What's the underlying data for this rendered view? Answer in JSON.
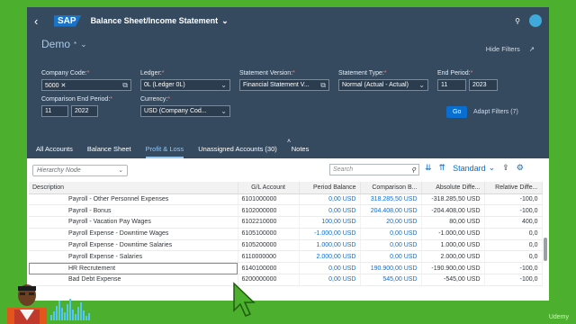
{
  "shell": {
    "brand": "SAP",
    "app_title": "Balance Sheet/Income Statement",
    "avatar_initials": ""
  },
  "header": {
    "variant": "Demo",
    "variant_marker": "*",
    "hide_filters": "Hide Filters",
    "go": "Go",
    "adapt_filters": "Adapt Filters (7)"
  },
  "filters": {
    "company_code": {
      "label": "Company Code:",
      "value": "5000"
    },
    "ledger": {
      "label": "Ledger:",
      "value": "0L (Ledger 0L)"
    },
    "statement_version": {
      "label": "Statement Version:",
      "value": "Financial Statement V..."
    },
    "statement_type": {
      "label": "Statement Type:",
      "value": "Normal (Actual - Actual)"
    },
    "end_period": {
      "label": "End Period:",
      "period": "11",
      "year": "2023"
    },
    "comparison_end_period": {
      "label": "Comparison End Period:",
      "period": "11",
      "year": "2022"
    },
    "currency": {
      "label": "Currency:",
      "value": "USD (Company Cod..."
    }
  },
  "tabs": [
    "All Accounts",
    "Balance Sheet",
    "Profit & Loss",
    "Unassigned Accounts (30)",
    "Notes"
  ],
  "active_tab": "Profit & Loss",
  "toolbar": {
    "hierarchy_placeholder": "Hierarchy Node",
    "search_placeholder": "Search",
    "standard": "Standard"
  },
  "table": {
    "headers": [
      "Description",
      "G/L Account",
      "Period Balance",
      "Comparison B...",
      "Absolute Diffe...",
      "Relative Diffe..."
    ],
    "rows": [
      {
        "desc": "Payroll - Other Personnel Expenses",
        "gl": "6101000000",
        "pb": "0,00 USD",
        "cb": "318.285,50 USD",
        "ad": "-318.285,50 USD",
        "rd": "-100,0"
      },
      {
        "desc": "Payroll - Bonus",
        "gl": "6102000000",
        "pb": "0,00 USD",
        "cb": "204.408,00 USD",
        "ad": "-204.408,00 USD",
        "rd": "-100,0"
      },
      {
        "desc": "Payroll - Vacation Pay Wages",
        "gl": "6102210000",
        "pb": "100,00 USD",
        "cb": "20,00 USD",
        "ad": "80,00 USD",
        "rd": "400,0"
      },
      {
        "desc": "Payroll Expense - Downtime Wages",
        "gl": "6105100000",
        "pb": "-1.000,00 USD",
        "cb": "0,00 USD",
        "ad": "-1.000,00 USD",
        "rd": "0,0"
      },
      {
        "desc": "Payroll Expense - Downtime Salaries",
        "gl": "6105200000",
        "pb": "1.000,00 USD",
        "cb": "0,00 USD",
        "ad": "1.000,00 USD",
        "rd": "0,0"
      },
      {
        "desc": "Payroll Expense - Salaries",
        "gl": "6110000000",
        "pb": "2.000,00 USD",
        "cb": "0,00 USD",
        "ad": "2.000,00 USD",
        "rd": "0,0"
      },
      {
        "desc": "HR Recrutement",
        "gl": "6140100000",
        "pb": "0,00 USD",
        "cb": "190.900,00 USD",
        "ad": "-190.900,00 USD",
        "rd": "-100,0"
      },
      {
        "desc": "Bad Debt Expense",
        "gl": "6200000000",
        "pb": "0,00 USD",
        "cb": "545,00 USD",
        "ad": "-545,00 USD",
        "rd": "-100,0"
      }
    ]
  },
  "watermark": "Udemy",
  "colors": {
    "shell": "#354a5f",
    "accent": "#0a6ed1",
    "background": "#4caf2e"
  }
}
